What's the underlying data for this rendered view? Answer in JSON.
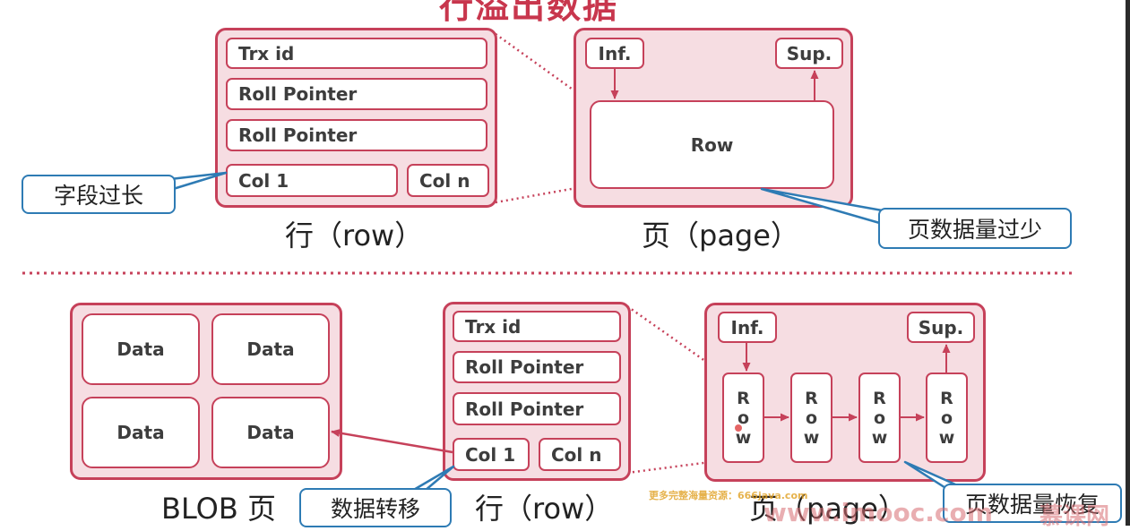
{
  "title": "行溢出数据",
  "top": {
    "row": {
      "fields": [
        "Trx id",
        "Roll Pointer",
        "Roll Pointer"
      ],
      "col1": "Col 1",
      "coln": "Col n",
      "caption": "行（row）"
    },
    "page": {
      "inf": "Inf.",
      "sup": "Sup.",
      "row": "Row",
      "caption": "页（page）"
    },
    "callout_left": "字段过长",
    "callout_right": "页数据量过少"
  },
  "bottom": {
    "blob": {
      "cells": [
        "Data",
        "Data",
        "Data",
        "Data"
      ],
      "caption": "BLOB 页"
    },
    "row": {
      "fields": [
        "Trx id",
        "Roll Pointer",
        "Roll Pointer"
      ],
      "col1": "Col 1",
      "coln": "Col n",
      "caption": "行（row）"
    },
    "page": {
      "inf": "Inf.",
      "sup": "Sup.",
      "rows": [
        "Row",
        "Row",
        "Row",
        "Row"
      ],
      "caption": "页（page）"
    },
    "callout_left": "数据转移",
    "callout_right": "页数据量恢复"
  },
  "watermark": {
    "small": "更多完整海量资源：666java.com",
    "big": "www.imooc.com",
    "logo": "慕课网"
  },
  "colors": {
    "accent_red": "#c6415a",
    "fill_pink": "#f6dde2",
    "callout_blue": "#2e7bb4"
  }
}
